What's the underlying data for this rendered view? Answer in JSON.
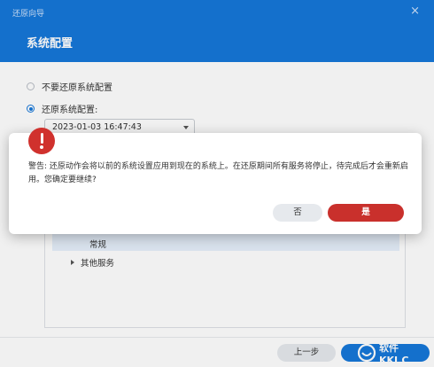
{
  "window": {
    "title": "还原向导",
    "close_glyph": "×"
  },
  "header": {
    "title": "系统配置"
  },
  "options": {
    "no_restore_label": "不要还原系统配置",
    "restore_label": "还原系统配置:",
    "selected_option": "restore"
  },
  "config_select": {
    "value": "2023-01-03 16:47:43"
  },
  "tree": {
    "items": [
      {
        "label": "常规",
        "selected": true
      },
      {
        "label": "其他服务",
        "selected": false
      }
    ]
  },
  "footer": {
    "prev_label": "上一步"
  },
  "dialog": {
    "icon": "warning-icon",
    "message": "警告: 还原动作会将以前的系统设置应用到现在的系统上。在还原期间所有服务将停止，待完成后才会重新启用。您确定要继续?",
    "no_label": "否",
    "yes_label": "是"
  },
  "watermark": {
    "text_top": "软件",
    "text_bottom": "KKJ.C"
  },
  "colors": {
    "header_blue": "#1677d9",
    "danger_red": "#c9302c",
    "selection_bg": "#e6f0fb"
  }
}
